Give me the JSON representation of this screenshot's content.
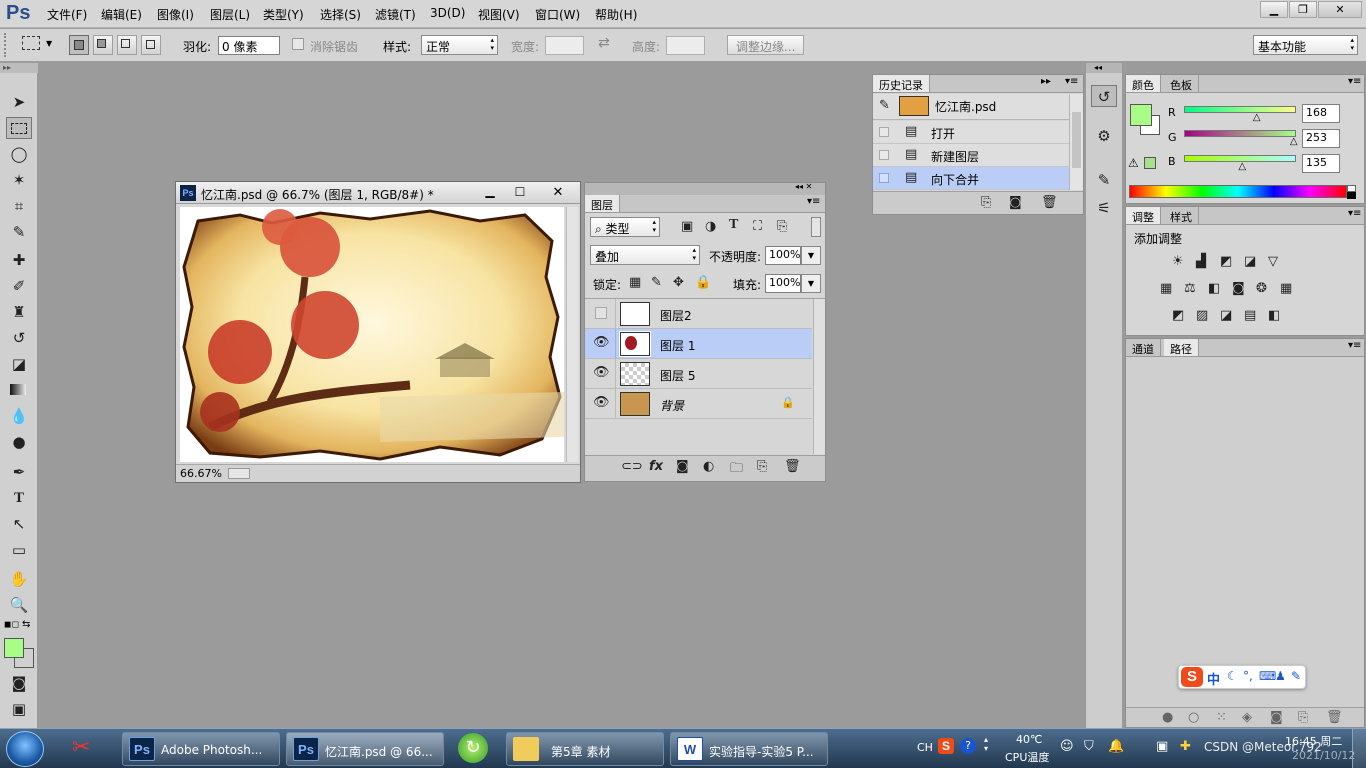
{
  "app": {
    "logo": "Ps"
  },
  "menu": [
    "文件(F)",
    "编辑(E)",
    "图像(I)",
    "图层(L)",
    "类型(Y)",
    "选择(S)",
    "滤镜(T)",
    "3D(D)",
    "视图(V)",
    "窗口(W)",
    "帮助(H)"
  ],
  "window_controls": {
    "minimize": "▁",
    "restore": "❐",
    "close": "✕"
  },
  "options": {
    "feather_label": "羽化:",
    "feather_value": "0 像素",
    "antialias_label": "消除锯齿",
    "style_label": "样式:",
    "style_value": "正常",
    "width_label": "宽度:",
    "height_label": "高度:",
    "refine_edge": "调整边缘...",
    "workspace": "基本功能"
  },
  "tools": [
    "move-tool",
    "marquee-tool",
    "lasso-tool",
    "magic-wand-tool",
    "crop-tool",
    "eyedropper-tool",
    "healing-brush-tool",
    "brush-tool",
    "clone-stamp-tool",
    "history-brush-tool",
    "eraser-tool",
    "gradient-tool",
    "blur-tool",
    "dodge-tool",
    "pen-tool",
    "type-tool",
    "path-selection-tool",
    "shape-tool",
    "hand-tool",
    "zoom-tool"
  ],
  "colors": {
    "foreground": "#a8fd87",
    "background": "#ffffff",
    "selection": "#b9cdf6"
  },
  "document": {
    "title": "忆江南.psd @ 66.7% (图层 1, RGB/8#) *",
    "zoom": "66.67%",
    "icon": "Ps"
  },
  "layers_panel": {
    "tab": "图层",
    "filter": "类型",
    "blend_mode": "叠加",
    "opacity_label": "不透明度:",
    "opacity": "100%",
    "lock_label": "锁定:",
    "fill_label": "填充:",
    "fill": "100%",
    "layers": [
      {
        "name": "图层2",
        "visible": false,
        "selected": false
      },
      {
        "name": "图层 1",
        "visible": true,
        "selected": true
      },
      {
        "name": "图层 5",
        "visible": true,
        "selected": false
      },
      {
        "name": "背景",
        "visible": true,
        "selected": false,
        "locked": true
      }
    ],
    "footer_icons": [
      "link-icon",
      "fx-icon",
      "mask-icon",
      "adjustment-icon",
      "group-icon",
      "new-layer-icon",
      "trash-icon"
    ]
  },
  "history_panel": {
    "tab": "历史记录",
    "snapshot": "忆江南.psd",
    "items": [
      "打开",
      "新建图层",
      "向下合并"
    ],
    "selected_index": 2
  },
  "color_panel": {
    "tabs": [
      "颜色",
      "色板"
    ],
    "r_label": "R",
    "g_label": "G",
    "b_label": "B",
    "r": "168",
    "g": "253",
    "b": "135",
    "r_pos": 0.66,
    "g_pos": 0.99,
    "b_pos": 0.53
  },
  "adjustments_panel": {
    "tabs": [
      "调整",
      "样式"
    ],
    "title": "添加调整"
  },
  "paths_panel": {
    "tabs": [
      "通道",
      "路径"
    ]
  },
  "ime": {
    "chars": "中",
    "logo": "S"
  },
  "taskbar": {
    "items": [
      {
        "label": "Adobe Photosh...",
        "icon": "Ps"
      },
      {
        "label": "忆江南.psd @ 66...",
        "icon": "Ps"
      },
      {
        "label": "第5章 素材",
        "icon": "📁"
      },
      {
        "label": "实验指导-实验5 P...",
        "icon": "W"
      }
    ],
    "tray": {
      "lang": "CH",
      "temp": "40℃",
      "temp_label": "CPU温度",
      "time": "16:45 周二",
      "date": "2021/10/12",
      "watermark": "CSDN @Meteor.792"
    }
  }
}
